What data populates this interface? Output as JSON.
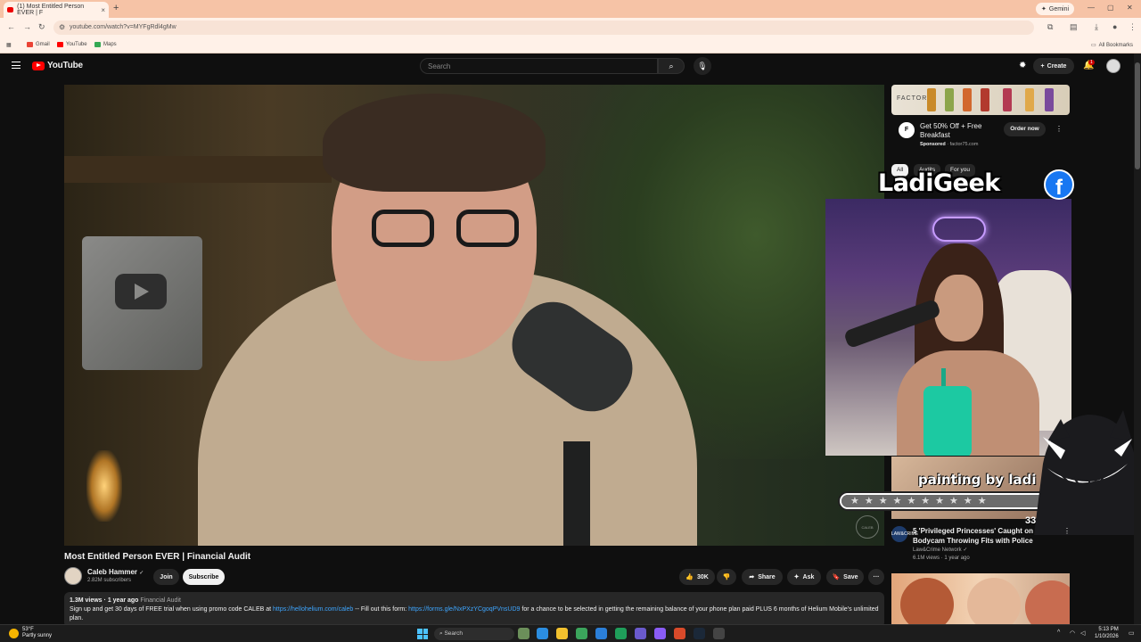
{
  "browser": {
    "tab_title": "(1) Most Entitled Person EVER | F",
    "tab_close": "×",
    "new_tab": "+",
    "gemini_label": "Gemini",
    "url": "youtube.com/watch?v=MYFgRdl4gMw",
    "bookmarks": [
      {
        "label": "Gmail",
        "color": "#ea4335"
      },
      {
        "label": "YouTube",
        "color": "#ff0000"
      },
      {
        "label": "Maps",
        "color": "#34a853"
      }
    ],
    "all_bookmarks": "All Bookmarks"
  },
  "youtube": {
    "logo_text": "YouTube",
    "search_placeholder": "Search",
    "create_label": "Create",
    "notification_count": "1"
  },
  "video": {
    "title": "Most Entitled Person EVER | Financial Audit",
    "channel": "Caleb Hammer",
    "verified": "✓",
    "subscribers": "2.82M subscribers",
    "join_label": "Join",
    "subscribe_label": "Subscribe",
    "likes": "30K",
    "share_label": "Share",
    "ask_label": "Ask",
    "save_label": "Save",
    "more_label": "···",
    "watermark": "CALEB HAMMER",
    "description": {
      "views": "1.3M views",
      "age": "1 year ago",
      "tag": "Financial Audit",
      "line_start": "Sign up and get 30 days of FREE trial when using promo code CALEB at ",
      "link1": "https://hellohelium.com/caleb",
      "line_mid": " -- Fill out this form: ",
      "link2": "https://forms.gle/NxPXzYCgoqPVnsUD9",
      "line_end": " for a chance to be selected in getting the remaining balance of your phone plan paid PLUS 6 months of Helium Mobile's unlimited plan."
    }
  },
  "ad": {
    "logo": "F",
    "title": "Get 50% Off + Free Breakfast",
    "sponsored": "Sponsored",
    "domain": "factor75.com",
    "cta": "Order now",
    "image_text": "FACTOR"
  },
  "chips": [
    "All",
    "Audits",
    "For you"
  ],
  "overlay": {
    "brand": "LadiGeek",
    "facebook": "f",
    "painting_text": "painting by ladi",
    "goal_count": "334 / 100",
    "stars": "★★★★★★★★★★"
  },
  "recommendation": {
    "channel_avatar": "LAW&CRIME",
    "title": "5 'Privileged Princesses' Caught on Bodycam Throwing Fits with Police",
    "channel": "Law&Crime Network",
    "views": "6.1M views",
    "age": "1 year ago"
  },
  "taskbar": {
    "temperature": "53°F",
    "weather": "Partly sunny",
    "search_label": "Search",
    "time": "5:13 PM",
    "date": "1/10/2026"
  },
  "colors": {
    "accent": "#ff0000",
    "link": "#3ea6ff",
    "background": "#0f0f0f"
  }
}
